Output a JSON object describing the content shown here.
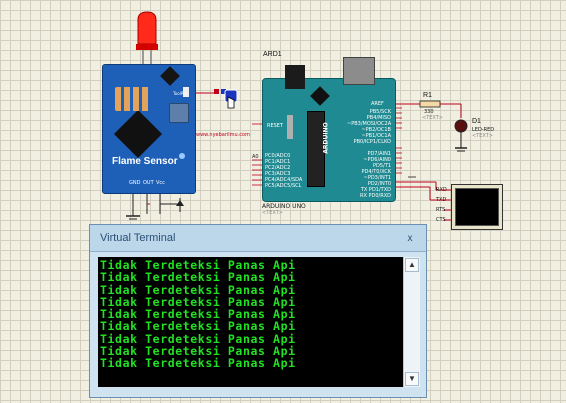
{
  "colors": {
    "background": "#f1efe2",
    "grid": "#d2cfbf",
    "terminal_text": "#22e022",
    "wire": "#c0001a",
    "board_blue": "#1e5fb7",
    "board_teal": "#1f8a91"
  },
  "flame_sensor": {
    "title": "Flame Sensor",
    "website": "www.nyebarilmu.com",
    "pins": [
      "GND",
      "OUT",
      "Vcc"
    ],
    "power_label": "ToolPro"
  },
  "arduino": {
    "ref": "ARD1",
    "model": "ARDUINO UNO",
    "text_placeholder": "<TEXT>",
    "brand": "ARDUINO",
    "reset_label": "RESET",
    "aref_label": "AREF",
    "left_pins": [
      "PC0/ADC0",
      "PC1/ADC1",
      "PC2/ADC2",
      "PC3/ADC3",
      "PC4/ADC4/SDA",
      "PC5/ADC5/SCL"
    ],
    "right_pins_top": [
      "PB5/SCK",
      "PB4/MISO",
      "~PB3/MOSI/OC2A",
      "~PB2/OC1B",
      "~PB1/OC1A",
      "PB0/ICP1/CLKO"
    ],
    "right_pins_bottom": [
      "PD7/AIN1",
      "~PD6/AIN0",
      "PD5/T1",
      "PD4/T0/XCK",
      "~PD3/INT1",
      "PD2/INT0",
      "TX PD1/TXD",
      "RX PD0/RXD"
    ],
    "analog_label": "A0"
  },
  "resistor": {
    "ref": "R1",
    "value": "330",
    "text_placeholder": "<TEXT>"
  },
  "led": {
    "ref": "D1",
    "type": "LED-RED",
    "text_placeholder": "<TEXT>"
  },
  "virtual_terminal_device": {
    "pins": [
      "RXD",
      "TXD",
      "RTS",
      "CTS"
    ]
  },
  "terminal_window": {
    "title": "Virtual Terminal",
    "close_label": "x",
    "lines": [
      "Tidak Terdeteksi Panas Api",
      "Tidak Terdeteksi Panas Api",
      "Tidak Terdeteksi Panas Api",
      "Tidak Terdeteksi Panas Api",
      "Tidak Terdeteksi Panas Api",
      "Tidak Terdeteksi Panas Api",
      "Tidak Terdeteksi Panas Api",
      "Tidak Terdeteksi Panas Api",
      "Tidak Terdeteksi Panas Api"
    ],
    "scroll_up_icon": "triangle-up",
    "scroll_down_icon": "triangle-down"
  },
  "icons": {
    "cursor": "hand-pointer-icon",
    "flame": "flame-led-icon"
  }
}
